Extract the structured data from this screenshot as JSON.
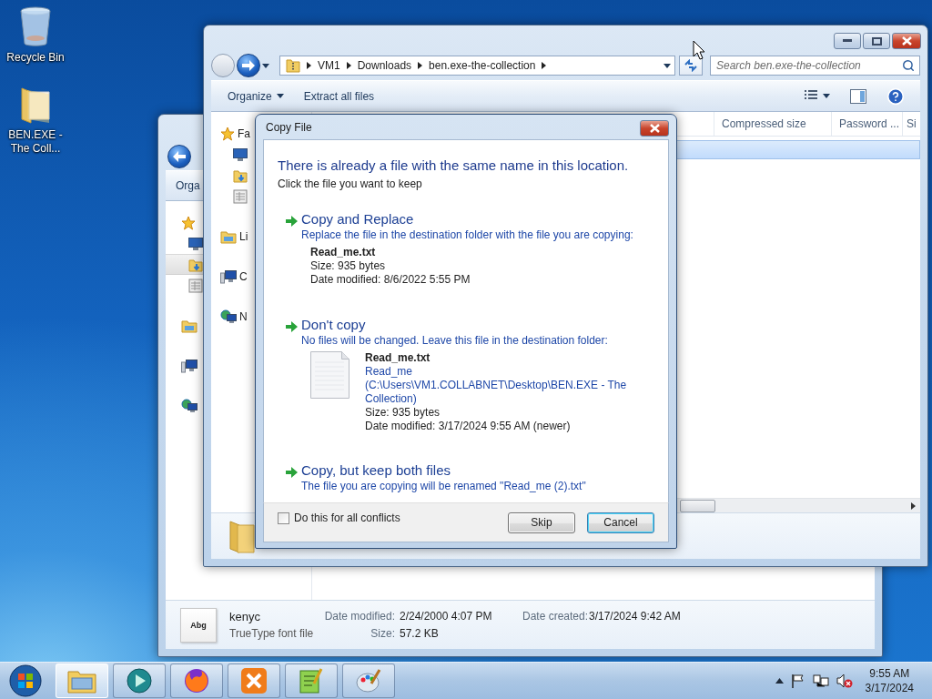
{
  "desktop_icons": [
    {
      "kind": "recycle_bin",
      "label": "Recycle Bin"
    },
    {
      "kind": "folder",
      "label": "BEN.EXE - The Coll..."
    }
  ],
  "back_window": {
    "toolbar": [
      {
        "label": "Orga"
      }
    ],
    "nav_tree": [
      {
        "kind": "favorites",
        "selected": false,
        "children": [
          {
            "kind": "desktop",
            "selected": false
          },
          {
            "kind": "downloads",
            "selected": true
          },
          {
            "kind": "recent",
            "selected": false
          }
        ]
      },
      {
        "kind": "libraries",
        "selected": false
      },
      {
        "kind": "computer",
        "selected": false
      },
      {
        "kind": "network",
        "selected": false
      }
    ],
    "details": {
      "preview": "Abg",
      "name": "kenyc",
      "type": "TrueType font file",
      "fields": [
        {
          "label": "Date modified:",
          "value": "2/24/2000 4:07 PM"
        },
        {
          "label": "Date created:",
          "value": "3/17/2024 9:42 AM"
        },
        {
          "label": "Size:",
          "value": "57.2 KB"
        }
      ]
    }
  },
  "explorer": {
    "breadcrumbs": [
      "VM1",
      "Downloads",
      "ben.exe-the-collection"
    ],
    "search": {
      "placeholder": "Search ben.exe-the-collection"
    },
    "toolbar": [
      {
        "label": "Organize",
        "dropdown": true
      },
      {
        "label": "Extract all files",
        "dropdown": false
      }
    ],
    "nav_tree": [
      {
        "kind": "favorites",
        "label": "Fa",
        "selected": false,
        "children": [
          {
            "kind": "desktop",
            "selected": false
          },
          {
            "kind": "downloads",
            "selected": false
          },
          {
            "kind": "recent",
            "selected": false
          }
        ]
      },
      {
        "kind": "libraries",
        "label": "Li",
        "selected": false
      },
      {
        "kind": "computer",
        "label": "C",
        "selected": false
      },
      {
        "kind": "network",
        "label": "N",
        "selected": false
      }
    ],
    "columns": [
      "Compressed size",
      "Password ...",
      "Si"
    ],
    "rows": [
      {
        "selected": true
      }
    ]
  },
  "dialog": {
    "title": "Copy File",
    "heading": "There is already a file with the same name in this location.",
    "subheading": "Click the file you want to keep",
    "options": [
      {
        "title": "Copy and Replace",
        "description": "Replace the file in the destination folder with the file you are copying:",
        "file": {
          "name": "Read_me.txt",
          "thumbnail": false,
          "lines": [
            "Size: 935 bytes",
            "Date modified: 8/6/2022 5:55 PM"
          ]
        }
      },
      {
        "title": "Don't copy",
        "description": "No files will be changed. Leave this file in the destination folder:",
        "file": {
          "name": "Read_me.txt",
          "thumbnail": true,
          "location": "Read_me (C:\\Users\\VM1.COLLABNET\\Desktop\\BEN.EXE - The Collection)",
          "lines": [
            "Size: 935 bytes",
            "Date modified: 3/17/2024 9:55 AM (newer)"
          ]
        }
      },
      {
        "title": "Copy, but keep both files",
        "description": "The file you are copying will be renamed \"Read_me (2).txt\""
      }
    ],
    "checkbox": {
      "label": "Do this for all conflicts",
      "checked": false
    },
    "buttons": [
      {
        "label": "Skip",
        "default": false
      },
      {
        "label": "Cancel",
        "default": true
      }
    ]
  },
  "taskbar": {
    "apps": [
      {
        "kind": "explorer",
        "selected": true
      },
      {
        "kind": "media",
        "selected": false
      },
      {
        "kind": "firefox",
        "selected": false
      },
      {
        "kind": "xampp",
        "selected": false
      },
      {
        "kind": "notepad",
        "selected": false
      },
      {
        "kind": "paint",
        "selected": false
      }
    ],
    "clock": {
      "time": "9:55 AM",
      "date": "3/17/2024"
    }
  }
}
